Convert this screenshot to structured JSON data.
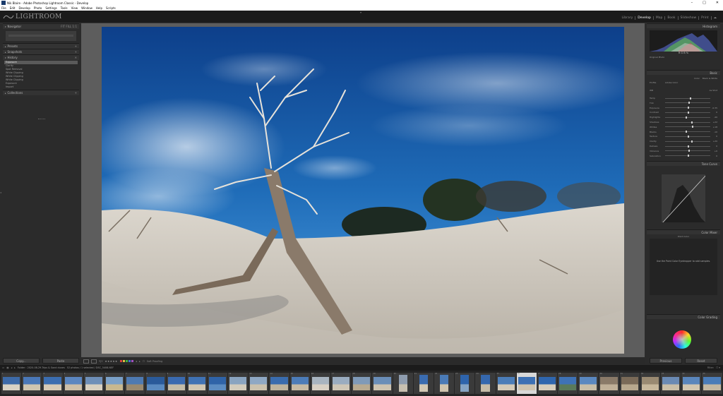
{
  "window": {
    "title": "Nik Blaire - Adobe Photoshop Lightroom Classic - Develop"
  },
  "menu": [
    "File",
    "Edit",
    "Develop",
    "Photo",
    "Settings",
    "Tools",
    "View",
    "Window",
    "Help",
    "Scripts"
  ],
  "logo": {
    "text": "LIGHTROOM"
  },
  "modules": [
    {
      "label": "Library",
      "active": false
    },
    {
      "label": "Develop",
      "active": true
    },
    {
      "label": "Map",
      "active": false
    },
    {
      "label": "Book",
      "active": false
    },
    {
      "label": "Slideshow",
      "active": false
    },
    {
      "label": "Print",
      "active": false
    },
    {
      "label": "Web",
      "active": false
    }
  ],
  "left_panel": {
    "navigator": "Navigator",
    "presets": "Presets",
    "snapshots": "Snapshots",
    "history": "History",
    "history_items": [
      {
        "label": "Exposure",
        "selected": true
      },
      {
        "label": "Clarity",
        "selected": false
      },
      {
        "label": "Spot Removal",
        "selected": false
      },
      {
        "label": "White Clipping",
        "selected": false
      },
      {
        "label": "White Clipping",
        "selected": false
      },
      {
        "label": "White Clipping",
        "selected": false
      },
      {
        "label": "Exposure",
        "selected": false
      },
      {
        "label": "Import",
        "selected": false
      }
    ],
    "collections": "Collections",
    "copy_button": "Copy...",
    "paste_button": "Paste"
  },
  "toolbar": {
    "stars": "★★★★★",
    "soft_proofing": "Soft Proofing",
    "flag_colors": [
      "#d84040",
      "#e0c040",
      "#40b040",
      "#4070d0",
      "#a050c0"
    ]
  },
  "right_panel": {
    "histogram": "Histogram",
    "readout": "R  G  B  %",
    "original_photo": "Original Photo",
    "basic": "Basic",
    "treatment": [
      "Color",
      "Black & White"
    ],
    "profile_label": "Profile",
    "profile_value": "Adobe Color",
    "wb_label": "WB",
    "wb_value": "As Shot",
    "sliders": [
      {
        "label": "Temp",
        "pos": 0.55,
        "value": ""
      },
      {
        "label": "Tint",
        "pos": 0.52,
        "value": ""
      },
      {
        "label": "Exposure",
        "pos": 0.5,
        "value": "-0.35"
      },
      {
        "label": "Contrast",
        "pos": 0.5,
        "value": "0"
      },
      {
        "label": "Highlights",
        "pos": 0.45,
        "value": "-40"
      },
      {
        "label": "Shadows",
        "pos": 0.58,
        "value": "+22"
      },
      {
        "label": "Whites",
        "pos": 0.6,
        "value": "+18"
      },
      {
        "label": "Blacks",
        "pos": 0.46,
        "value": "-10"
      },
      {
        "label": "Texture",
        "pos": 0.5,
        "value": "0"
      },
      {
        "label": "Clarity",
        "pos": 0.58,
        "value": "+20"
      },
      {
        "label": "Dehaze",
        "pos": 0.5,
        "value": "0"
      },
      {
        "label": "Vibrance",
        "pos": 0.52,
        "value": "+6"
      },
      {
        "label": "Saturation",
        "pos": 0.5,
        "value": "0"
      }
    ],
    "tone_curve": "Tone Curve",
    "color_mixer": "Color Mixer",
    "point_color": "Point Color",
    "point_color_msg": "Use the Point Color Eyedropper to add samples.",
    "color_grading": "Color Grading",
    "previous_button": "Previous",
    "reset_button": "Reset"
  },
  "filmstrip": {
    "path_label": "Folder : 2020-08-29-Trips & Sand dunes",
    "count_label": "52 photos / 1 selected / DSC_5408.NEF",
    "filter": "Filter:",
    "thumbnails": [
      {
        "num": "1",
        "kind": "land",
        "colors": [
          "#3d6aa8",
          "#d8d2c4"
        ]
      },
      {
        "num": "2",
        "kind": "land",
        "colors": [
          "#4a78b8",
          "#cfc5b0"
        ]
      },
      {
        "num": "3",
        "kind": "land",
        "colors": [
          "#3b6db0",
          "#d6cab6"
        ]
      },
      {
        "num": "4",
        "kind": "land",
        "colors": [
          "#5b86c0",
          "#cdbfa8"
        ]
      },
      {
        "num": "5",
        "kind": "land",
        "colors": [
          "#6e8fb8",
          "#d8d0c0"
        ]
      },
      {
        "num": "6",
        "kind": "land",
        "colors": [
          "#7aa0c8",
          "#c8b88f"
        ]
      },
      {
        "num": "7",
        "kind": "land",
        "colors": [
          "#4e7ab2",
          "#9a8a70"
        ]
      },
      {
        "num": "8",
        "kind": "land",
        "colors": [
          "#2a5a9a",
          "#5a8ac0"
        ]
      },
      {
        "num": "9",
        "kind": "land",
        "colors": [
          "#3a6ab0",
          "#c4bca8"
        ]
      },
      {
        "num": "10",
        "kind": "land",
        "colors": [
          "#3f72b4",
          "#d0c6b2"
        ]
      },
      {
        "num": "11",
        "kind": "land",
        "colors": [
          "#2f63a8",
          "#5c8cc2"
        ]
      },
      {
        "num": "12",
        "kind": "land",
        "colors": [
          "#8aa4c0",
          "#d4ccbc"
        ]
      },
      {
        "num": "13",
        "kind": "land",
        "colors": [
          "#8fa8c4",
          "#ccc2ae"
        ]
      },
      {
        "num": "14",
        "kind": "land",
        "colors": [
          "#3a6cae",
          "#bfb49e"
        ]
      },
      {
        "num": "15",
        "kind": "land",
        "colors": [
          "#4c7cb8",
          "#c6baa4"
        ]
      },
      {
        "num": "16",
        "kind": "land",
        "colors": [
          "#a8b4c0",
          "#d8d0c4"
        ]
      },
      {
        "num": "17",
        "kind": "land",
        "colors": [
          "#9aacc0",
          "#cfc6b6"
        ]
      },
      {
        "num": "18",
        "kind": "land",
        "colors": [
          "#7f9ab8",
          "#b8aa90"
        ]
      },
      {
        "num": "19",
        "kind": "land",
        "colors": [
          "#6a8eb8",
          "#cdc3b0"
        ]
      },
      {
        "num": "20",
        "kind": "portrait",
        "colors": [
          "#8e9cae",
          "#c8c0b0"
        ]
      },
      {
        "num": "21",
        "kind": "portrait",
        "colors": [
          "#3a6cb0",
          "#d2c8b4"
        ]
      },
      {
        "num": "22",
        "kind": "portrait",
        "colors": [
          "#4a7ab6",
          "#cfc4ae"
        ]
      },
      {
        "num": "23",
        "kind": "portrait",
        "colors": [
          "#2e64ac",
          "#86a4c4"
        ]
      },
      {
        "num": "24",
        "kind": "portrait",
        "colors": [
          "#3568ae",
          "#c6bca8"
        ]
      },
      {
        "num": "25",
        "kind": "land",
        "colors": [
          "#4b7db8",
          "#d4cab8"
        ]
      },
      {
        "num": "26",
        "kind": "land",
        "colors": [
          "#3c70b4",
          "#cec4b0"
        ],
        "selected": true
      },
      {
        "num": "27",
        "kind": "land",
        "colors": [
          "#2f66ae",
          "#d6cdbc"
        ]
      },
      {
        "num": "28",
        "kind": "land",
        "colors": [
          "#3e72b6",
          "#5a7a5a"
        ]
      },
      {
        "num": "29",
        "kind": "land",
        "colors": [
          "#5a88c0",
          "#c8bea8"
        ]
      },
      {
        "num": "30",
        "kind": "land",
        "colors": [
          "#8a7a68",
          "#c0b098"
        ]
      },
      {
        "num": "31",
        "kind": "land",
        "colors": [
          "#7a6a58",
          "#b8a88e"
        ]
      },
      {
        "num": "32",
        "kind": "land",
        "colors": [
          "#9a8a72",
          "#c8b89c"
        ]
      },
      {
        "num": "33",
        "kind": "land",
        "colors": [
          "#6a8ab4",
          "#cabfa8"
        ]
      },
      {
        "num": "34",
        "kind": "land",
        "colors": [
          "#5a86bc",
          "#d2c6b0"
        ]
      },
      {
        "num": "35",
        "kind": "land",
        "colors": [
          "#4a7cb8",
          "#c4b8a2"
        ]
      }
    ]
  },
  "colors": {
    "sky_top": "#0f4fa0",
    "sky_mid": "#2a7cc8",
    "sand": "#d9d3c8",
    "accent": "#ffffff"
  }
}
